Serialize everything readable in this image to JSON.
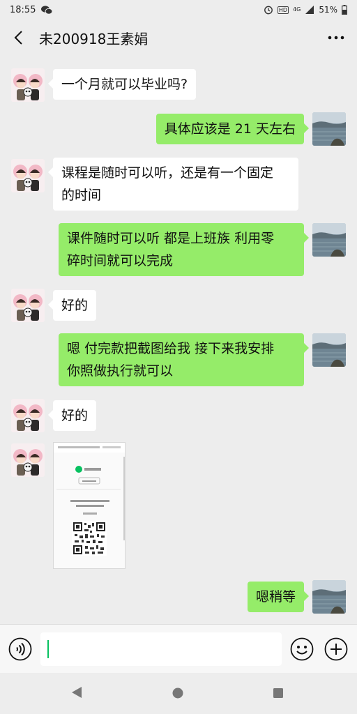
{
  "status_bar": {
    "time": "18:55",
    "hd_badge": "HD",
    "network": "4G",
    "battery": "51%"
  },
  "header": {
    "title": "未200918王素娟"
  },
  "messages": [
    {
      "side": "in",
      "type": "text",
      "text": "一个月就可以毕业吗?"
    },
    {
      "side": "out",
      "type": "text",
      "text": "具体应该是 21 天左右"
    },
    {
      "side": "in",
      "type": "text",
      "lines": [
        "课程是随时可以听，还是有一个固定",
        "的时间"
      ]
    },
    {
      "side": "out",
      "type": "text",
      "lines": [
        "课件随时可以听 都是上班族 利用零",
        "碎时间就可以完成"
      ]
    },
    {
      "side": "in",
      "type": "text",
      "text": "好的"
    },
    {
      "side": "out",
      "type": "text",
      "lines": [
        "嗯 付完款把截图给我 接下来我安排",
        "你照做执行就可以"
      ]
    },
    {
      "side": "in",
      "type": "text",
      "text": "好的"
    },
    {
      "side": "in",
      "type": "image",
      "caption": "payment-screenshot"
    },
    {
      "side": "out",
      "type": "text",
      "text": "嗯稍等"
    }
  ],
  "input": {
    "value": "",
    "placeholder": ""
  },
  "colors": {
    "background": "#ededed",
    "outgoing_bubble": "#95ec69",
    "incoming_bubble": "#ffffff",
    "accent": "#07c160"
  },
  "icons": {
    "back": "chevron-left-icon",
    "more": "more-dots-icon",
    "voice": "voice-icon",
    "emoji": "emoji-icon",
    "plus": "plus-icon"
  }
}
